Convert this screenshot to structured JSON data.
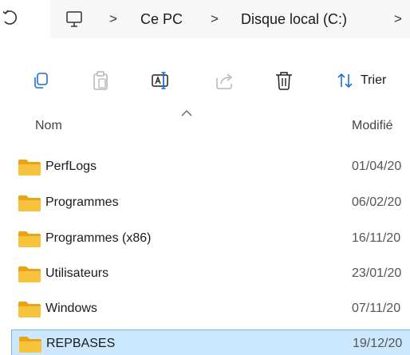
{
  "breadcrumb": {
    "items": [
      "Ce PC",
      "Disque local (C:)"
    ],
    "separator": ">"
  },
  "toolbar": {
    "icons": [
      "copy-icon",
      "paste-icon",
      "rename-icon",
      "share-icon",
      "delete-icon",
      "sort-icon"
    ],
    "sort_label": "Trier"
  },
  "columns": {
    "name": "Nom",
    "modified": "Modifié"
  },
  "files": [
    {
      "name": "PerfLogs",
      "date": "01/04/20"
    },
    {
      "name": "Programmes",
      "date": "06/02/20"
    },
    {
      "name": "Programmes (x86)",
      "date": "16/11/20"
    },
    {
      "name": "Utilisateurs",
      "date": "23/01/20"
    },
    {
      "name": "Windows",
      "date": "07/11/20"
    },
    {
      "name": "REPBASES",
      "date": "19/12/20",
      "selected": true
    }
  ],
  "colors": {
    "folder": "#f8c33c",
    "folder_dark": "#e8a317",
    "selection": "#cce8ff",
    "selection_border": "#7ab4e6",
    "disabled_icon": "#b5b5b5"
  }
}
